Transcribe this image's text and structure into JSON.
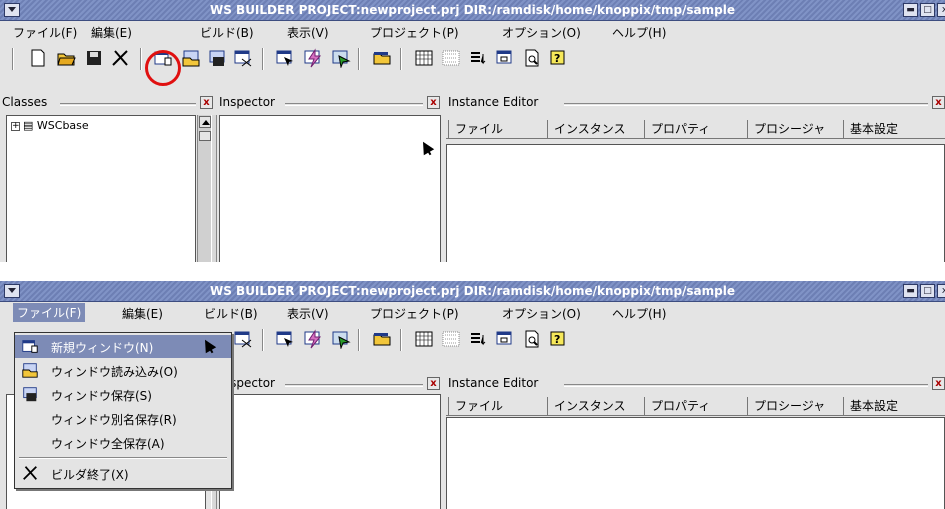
{
  "window": {
    "title": "WS BUILDER PROJECT:newproject.prj DIR:/ramdisk/home/knoppix/tmp/sample",
    "titlebar_buttons": [
      "minimize-icon",
      "maximize-icon",
      "close-icon"
    ]
  },
  "menubar": {
    "items": [
      "ファイル(F)",
      "編集(E)",
      "ビルド(B)",
      "表示(V)",
      "プロジェクト(P)",
      "オプション(O)",
      "ヘルプ(H)"
    ]
  },
  "toolbar": {
    "icons": [
      "new-project-icon",
      "open-folder-icon",
      "save-disk-icon",
      "exit-builder-icon",
      "new-window-icon",
      "load-window-icon",
      "save-window-icon",
      "delete-window-icon",
      "build-icon",
      "compile-icon",
      "run-icon",
      "folder-icon",
      "grid-icon",
      "dotted-grid-icon",
      "list-icon",
      "inspect-icon",
      "preview-icon",
      "help-icon"
    ],
    "highlighted_icon": "new-window-icon",
    "highlight_color": "#e01010"
  },
  "panes": {
    "classes": {
      "title": "Classes",
      "tree_item": "WSCbase"
    },
    "inspector": {
      "title": "Inspector"
    },
    "instance_editor": {
      "title": "Instance Editor",
      "tabs": [
        "ファイル",
        "インスタンス",
        "プロパティ",
        "プロシージャ",
        "基本設定"
      ]
    }
  },
  "file_menu": {
    "items": [
      {
        "icon": "new-window-icon",
        "label": "新規ウィンドウ(N)",
        "highlighted": true
      },
      {
        "icon": "load-window-icon",
        "label": "ウィンドウ読み込み(O)",
        "highlighted": false
      },
      {
        "icon": "save-window-icon",
        "label": "ウィンドウ保存(S)",
        "highlighted": false
      },
      {
        "icon": "",
        "label": "ウィンドウ別名保存(R)",
        "highlighted": false
      },
      {
        "icon": "",
        "label": "ウィンドウ全保存(A)",
        "highlighted": false
      },
      {
        "icon": "exit-builder-icon",
        "label": "ビルダ終了(X)",
        "highlighted": false
      }
    ]
  },
  "colors": {
    "titlebar": "#7d8bb6",
    "menu_highlight": "#7d8bb6",
    "background": "#e4e4e4"
  }
}
